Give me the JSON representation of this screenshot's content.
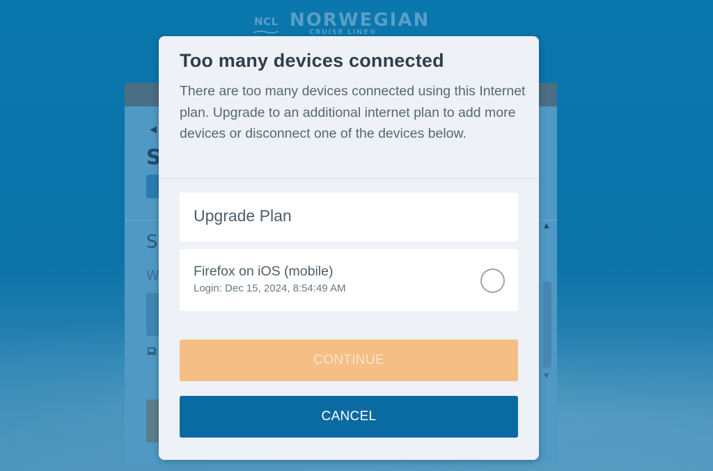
{
  "brand": {
    "ncl": "NCL",
    "name": "NORWEGIAN",
    "sub": "CRUISE LINE®"
  },
  "background": {
    "title_fragment": "S",
    "section_fragment": "S",
    "text_fragment": "W"
  },
  "modal": {
    "title": "Too many devices connected",
    "description": "There are too many devices connected using this Internet plan. Upgrade to an additional internet plan to add more devices or disconnect one of the devices below.",
    "upgrade_label": "Upgrade Plan",
    "devices": [
      {
        "name": "Firefox on iOS (mobile)",
        "login": "Login: Dec 15, 2024, 8:54:49 AM",
        "selected": false
      }
    ],
    "continue_label": "CONTINUE",
    "cancel_label": "CANCEL"
  },
  "colors": {
    "primary": "#0a6aa2",
    "continue_disabled": "#f4be84",
    "modal_bg": "#eef1f6",
    "page_bg": "#0a77ad"
  },
  "icons": {
    "back": "chevron-left-icon",
    "device": "laptop-icon",
    "scroll_up": "caret-up-icon",
    "scroll_down": "caret-down-icon"
  }
}
